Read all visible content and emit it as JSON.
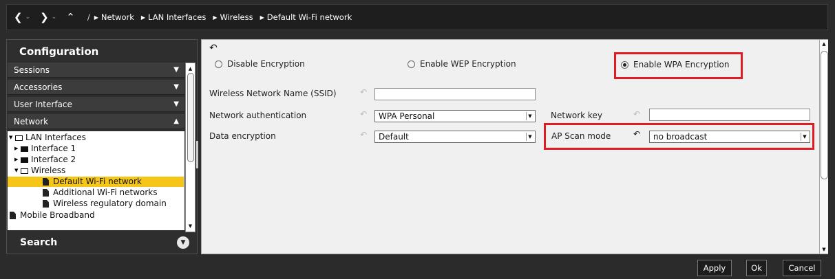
{
  "breadcrumb": {
    "root": "/",
    "items": [
      "Network",
      "LAN Interfaces",
      "Wireless",
      "Default Wi-Fi network"
    ]
  },
  "sidebar": {
    "title": "Configuration",
    "sections": [
      "Sessions",
      "Accessories",
      "User Interface",
      "Network"
    ],
    "tree": {
      "lan": "LAN Interfaces",
      "if1": "Interface 1",
      "if2": "Interface 2",
      "wireless": "Wireless",
      "default_wifi": "Default Wi-Fi network",
      "additional_wifi": "Additional Wi-Fi networks",
      "regulatory": "Wireless regulatory domain",
      "mobile": "Mobile Broadband"
    },
    "search": "Search"
  },
  "encryption": {
    "disable": "Disable Encryption",
    "wep": "Enable WEP Encryption",
    "wpa": "Enable WPA Encryption",
    "selected": "wpa"
  },
  "form": {
    "ssid_label": "Wireless Network Name (SSID)",
    "ssid_value": "",
    "auth_label": "Network authentication",
    "auth_value": "WPA Personal",
    "key_label": "Network key",
    "key_value": "",
    "enc_label": "Data encryption",
    "enc_value": "Default",
    "ap_label": "AP Scan mode",
    "ap_value": "no broadcast"
  },
  "buttons": {
    "apply": "Apply",
    "ok": "Ok",
    "cancel": "Cancel"
  },
  "colors": {
    "highlight": "#e01b24",
    "selection": "#f5c518"
  }
}
